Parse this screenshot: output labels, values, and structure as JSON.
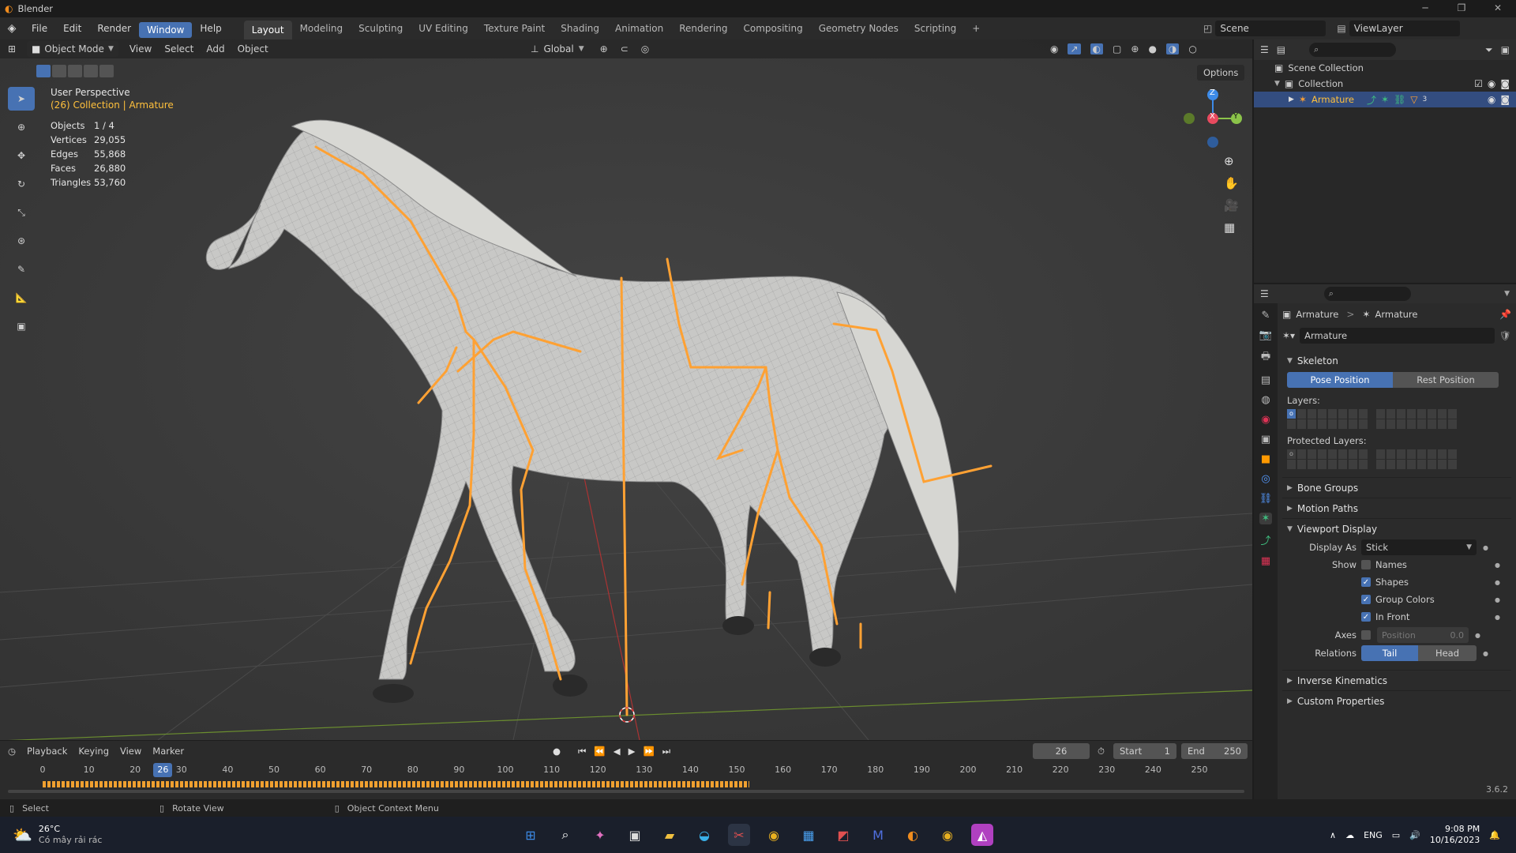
{
  "titlebar": {
    "app": "Blender",
    "min": "─",
    "max": "❐",
    "close": "✕"
  },
  "menubar": {
    "items": [
      "File",
      "Edit",
      "Render",
      "Window",
      "Help"
    ],
    "active": "Window"
  },
  "workspaces": {
    "tabs": [
      "Layout",
      "Modeling",
      "Sculpting",
      "UV Editing",
      "Texture Paint",
      "Shading",
      "Animation",
      "Rendering",
      "Compositing",
      "Geometry Nodes",
      "Scripting"
    ],
    "active": "Layout",
    "add": "+"
  },
  "scene": {
    "name": "Scene",
    "view_layer": "ViewLayer"
  },
  "viewport_header": {
    "mode": "Object Mode",
    "menus": [
      "View",
      "Select",
      "Add",
      "Object"
    ],
    "orientation": "Global",
    "options": "Options"
  },
  "overlay_info": {
    "title": "User Perspective",
    "subtitle": "(26) Collection | Armature",
    "stats": [
      {
        "label": "Objects",
        "value": "1 / 4"
      },
      {
        "label": "Vertices",
        "value": "29,055"
      },
      {
        "label": "Edges",
        "value": "55,868"
      },
      {
        "label": "Faces",
        "value": "26,880"
      },
      {
        "label": "Triangles",
        "value": "53,760"
      }
    ]
  },
  "gizmo": {
    "x": "X",
    "y": "Y",
    "z": "Z"
  },
  "outliner": {
    "scene_collection": "Scene Collection",
    "collection": "Collection",
    "armature": "Armature",
    "vis_badge": "3"
  },
  "props": {
    "breadcrumb_a": "Armature",
    "breadcrumb_sep": ">",
    "breadcrumb_b": "Armature",
    "data_name": "Armature",
    "skeleton": "Skeleton",
    "pose_position": "Pose Position",
    "rest_position": "Rest Position",
    "layers": "Layers:",
    "protected_layers": "Protected Layers:",
    "layer_mark": "o",
    "bone_groups": "Bone Groups",
    "motion_paths": "Motion Paths",
    "viewport_display": "Viewport Display",
    "display_as_label": "Display As",
    "display_as_value": "Stick",
    "show_label": "Show",
    "names": "Names",
    "shapes": "Shapes",
    "group_colors": "Group Colors",
    "in_front": "In Front",
    "axes_label": "Axes",
    "axes_position": "Position",
    "axes_value": "0.0",
    "relations_label": "Relations",
    "tail": "Tail",
    "head": "Head",
    "inverse_kinematics": "Inverse Kinematics",
    "custom_properties": "Custom Properties",
    "version": "3.6.2"
  },
  "checks": {
    "names": false,
    "shapes": true,
    "group_colors": true,
    "in_front": true,
    "axes": false
  },
  "timeline": {
    "menus": [
      "Playback",
      "Keying",
      "View",
      "Marker"
    ],
    "current": "26",
    "start_label": "Start",
    "start": "1",
    "end_label": "End",
    "end": "250",
    "ticks": [
      "0",
      "10",
      "20",
      "30",
      "40",
      "50",
      "60",
      "70",
      "80",
      "90",
      "100",
      "110",
      "120",
      "130",
      "140",
      "150",
      "160",
      "170",
      "180",
      "190",
      "200",
      "210",
      "220",
      "230",
      "240",
      "250"
    ]
  },
  "statusbar": {
    "select": "Select",
    "rotate": "Rotate View",
    "context": "Object Context Menu"
  },
  "taskbar": {
    "temp": "26°C",
    "weather": "Có mây rải rác",
    "lang": "ENG",
    "time": "9:08 PM",
    "date": "10/16/2023"
  },
  "colors": {
    "accent": "#4772b3",
    "bone": "#ffa133",
    "active_text": "#ffc03c",
    "axis_x": "#e84a5f",
    "axis_y": "#8bc34a",
    "axis_z": "#3d8be8"
  }
}
